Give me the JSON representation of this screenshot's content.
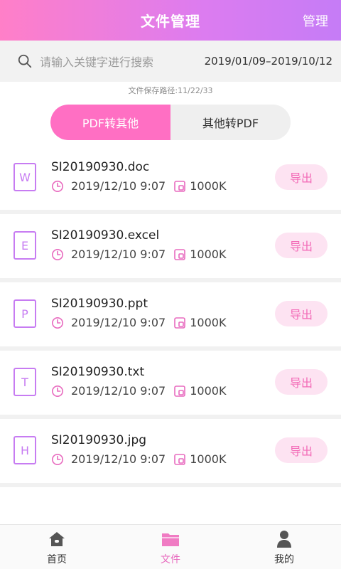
{
  "header": {
    "title": "文件管理",
    "manage_label": "管理"
  },
  "search": {
    "placeholder": "请输入关键字进行搜索",
    "date_range": "2019/01/09–2019/10/12"
  },
  "save_path": "文件保存路径:11/22/33",
  "segment": {
    "left_label": "PDF转其他",
    "right_label": "其他转PDF",
    "active": "left"
  },
  "files": [
    {
      "letter": "W",
      "name": "SI20190930.doc",
      "time": "2019/12/10 9:07",
      "size": "1000K",
      "action": "导出"
    },
    {
      "letter": "E",
      "name": "SI20190930.excel",
      "time": "2019/12/10 9:07",
      "size": "1000K",
      "action": "导出"
    },
    {
      "letter": "P",
      "name": "SI20190930.ppt",
      "time": "2019/12/10 9:07",
      "size": "1000K",
      "action": "导出"
    },
    {
      "letter": "T",
      "name": "SI20190930.txt",
      "time": "2019/12/10 9:07",
      "size": "1000K",
      "action": "导出"
    },
    {
      "letter": "H",
      "name": "SI20190930.jpg",
      "time": "2019/12/10 9:07",
      "size": "1000K",
      "action": "导出"
    }
  ],
  "tabbar": {
    "items": [
      {
        "label": "首页",
        "icon": "home-icon",
        "active": false
      },
      {
        "label": "文件",
        "icon": "folder-icon",
        "active": true
      },
      {
        "label": "我的",
        "icon": "person-icon",
        "active": false
      }
    ]
  },
  "colors": {
    "accent": "#ff6fc3",
    "accent_purple": "#c77cf2",
    "export_bg": "#fde3f2"
  }
}
